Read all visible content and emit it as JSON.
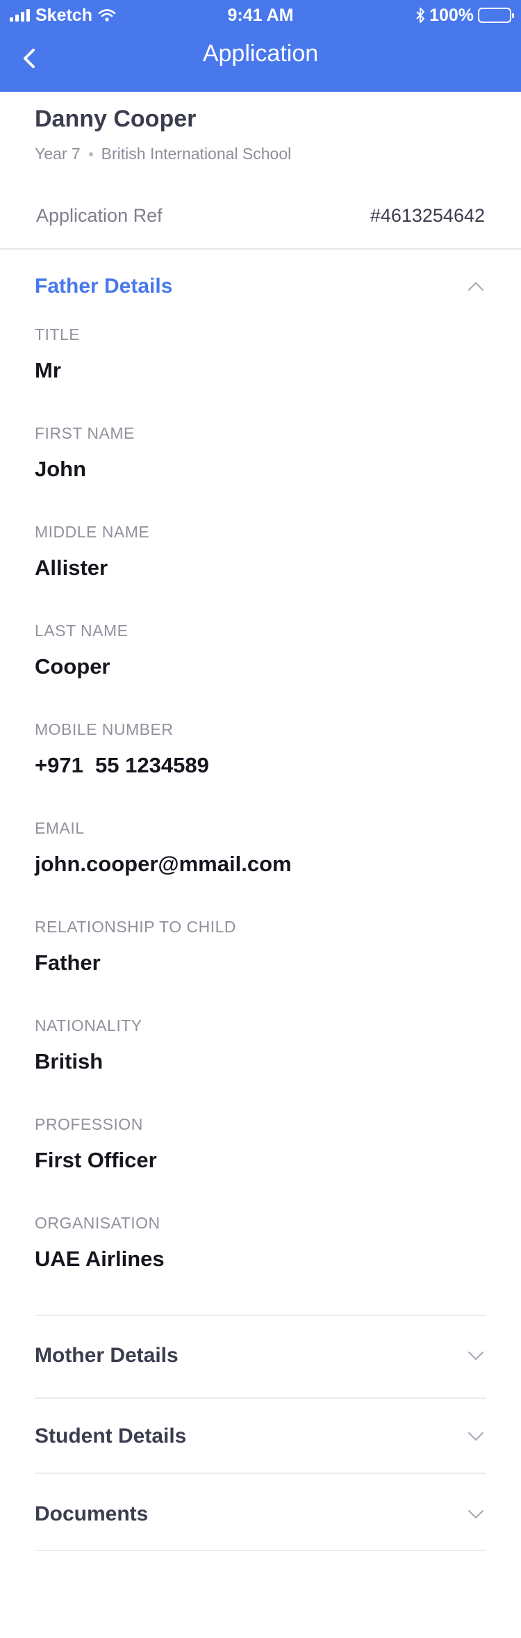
{
  "status_bar": {
    "carrier": "Sketch",
    "time": "9:41 AM",
    "battery": "100%"
  },
  "nav": {
    "title": "Application"
  },
  "student": {
    "name": "Danny Cooper",
    "year": "Year 7",
    "school": "British International School"
  },
  "application_ref": {
    "label": "Application Ref",
    "value": "#4613254642"
  },
  "father_section": {
    "title": "Father Details",
    "fields": [
      {
        "label": "TITLE",
        "value": "Mr"
      },
      {
        "label": "FIRST NAME",
        "value": "John"
      },
      {
        "label": "MIDDLE NAME",
        "value": "Allister"
      },
      {
        "label": "LAST NAME",
        "value": "Cooper"
      },
      {
        "label": "MOBILE NUMBER",
        "value": "+971  55 1234589"
      },
      {
        "label": "EMAIL",
        "value": "john.cooper@mmail.com"
      },
      {
        "label": "RELATIONSHIP TO CHILD",
        "value": "Father"
      },
      {
        "label": "NATIONALITY",
        "value": "British"
      },
      {
        "label": "PROFESSION",
        "value": "First Officer"
      },
      {
        "label": "ORGANISATION",
        "value": "UAE Airlines"
      }
    ]
  },
  "collapsed_sections": [
    {
      "title": "Mother Details"
    },
    {
      "title": "Student Details"
    },
    {
      "title": "Documents"
    }
  ],
  "colors": {
    "accent": "#4878ec",
    "heading": "#3b3d4f",
    "label": "#8f929d"
  },
  "icons": {
    "back": "chevron-left-icon",
    "expanded": "chevron-up-icon",
    "collapsed": "chevron-down-icon"
  }
}
